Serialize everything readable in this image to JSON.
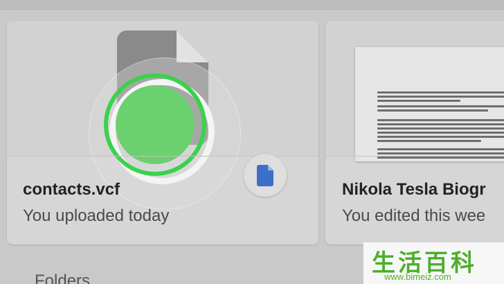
{
  "cards": [
    {
      "title": "contacts.vcf",
      "subtitle": "You uploaded today",
      "thumb_icon": "file-icon",
      "type_icon": "google-docs-icon"
    },
    {
      "title": "Nikola Tesla Biogr",
      "subtitle": "You edited this wee",
      "preview_text": [
        "June Tesla symbolises a exciting force and inspiration for all relevant to the",
        "development of the field of scientific development. New York ",
        "May 10, Tesla's birthday: Nikola Tesla Day.",
        "Microfilm United States Congressional gave speeches in Tribute of Tesla with tribute to",
        "the Tesla Science Center, Wardenclyffe, Shoreham, New York, and others",
        "The seven ago 'Nikola Tesla Corner' was recently placed at the corner of the street",
        "photos of Tesla in the Statue of Liberty Museum. The Liberty Science Center in Jersey City",
        "Tesla Mad Lab, which is located in the Science Museum of Tesla",
        "Nikola Tesla Co. is a large car company founded, named after the inventor",
        "Nikola Tesla was born on July 10, 1856 in Smiljan, who was first part of the Austrian",
        "Military Frontier of the Austrian Empire, now part of Croatia"
      ]
    }
  ],
  "folders_label": "Folders",
  "watermark": {
    "chars": "生活百科",
    "url": "www.bimeiz.com"
  }
}
